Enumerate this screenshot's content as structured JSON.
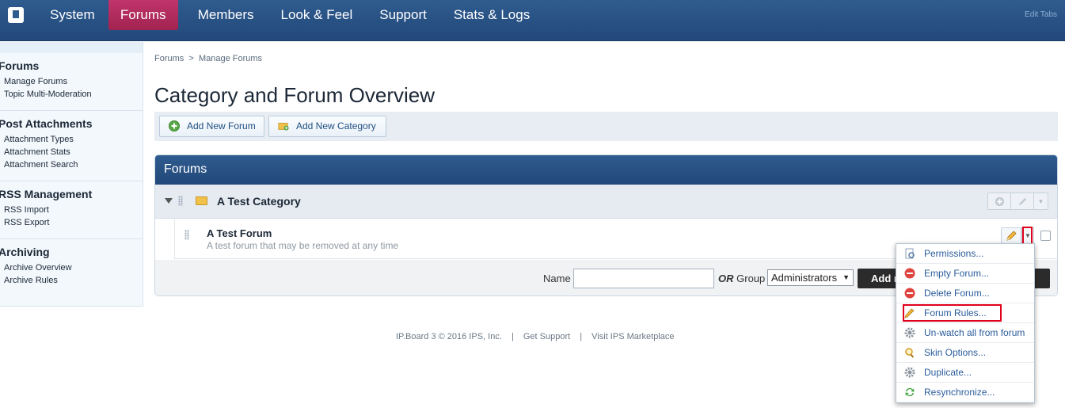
{
  "nav": {
    "items": [
      "System",
      "Forums",
      "Members",
      "Look & Feel",
      "Support",
      "Stats & Logs"
    ],
    "active": "Forums",
    "edit_tabs": "Edit Tabs"
  },
  "sidebar": {
    "sections": [
      {
        "title": "Forums",
        "links": [
          "Manage Forums",
          "Topic Multi-Moderation"
        ]
      },
      {
        "title": "Post Attachments",
        "links": [
          "Attachment Types",
          "Attachment Stats",
          "Attachment Search"
        ]
      },
      {
        "title": "RSS Management",
        "links": [
          "RSS Import",
          "RSS Export"
        ]
      },
      {
        "title": "Archiving",
        "links": [
          "Archive Overview",
          "Archive Rules"
        ]
      }
    ]
  },
  "breadcrumb": {
    "root": "Forums",
    "sep": ">",
    "current": "Manage Forums"
  },
  "page_title": "Category and Forum Overview",
  "toolbar": {
    "add_forum": "Add New Forum",
    "add_category": "Add New Category"
  },
  "forums": {
    "header": "Forums",
    "category": {
      "title": "A Test Category"
    },
    "forum": {
      "title": "A Test Forum",
      "description": "A test forum that may be removed at any time"
    }
  },
  "add_bar": {
    "name_label": "Name",
    "name_value": "",
    "or_label": "OR",
    "group_label": "Group",
    "group_selected": "Administrators",
    "add_button": "Add r"
  },
  "footer": {
    "copyright": "IP.Board 3 © 2016 IPS, Inc.",
    "sep": "|",
    "support": "Get Support",
    "marketplace": "Visit IPS Marketplace"
  },
  "menu": {
    "items": [
      {
        "label": "Permissions...",
        "icon": "permissions-icon"
      },
      {
        "label": "Empty Forum...",
        "icon": "empty-icon"
      },
      {
        "label": "Delete Forum...",
        "icon": "delete-icon"
      },
      {
        "label": "Forum Rules...",
        "icon": "pencil-icon"
      },
      {
        "label": "Un-watch all from forum",
        "icon": "gear-icon"
      },
      {
        "label": "Skin Options...",
        "icon": "magnifier-icon"
      },
      {
        "label": "Duplicate...",
        "icon": "gear-icon"
      },
      {
        "label": "Resynchronize...",
        "icon": "sync-icon"
      }
    ]
  },
  "colors": {
    "nav_bg": "#2f5b8e",
    "nav_active": "#b02b5d",
    "link": "#2a5c9a",
    "highlight": "#e0001b"
  }
}
